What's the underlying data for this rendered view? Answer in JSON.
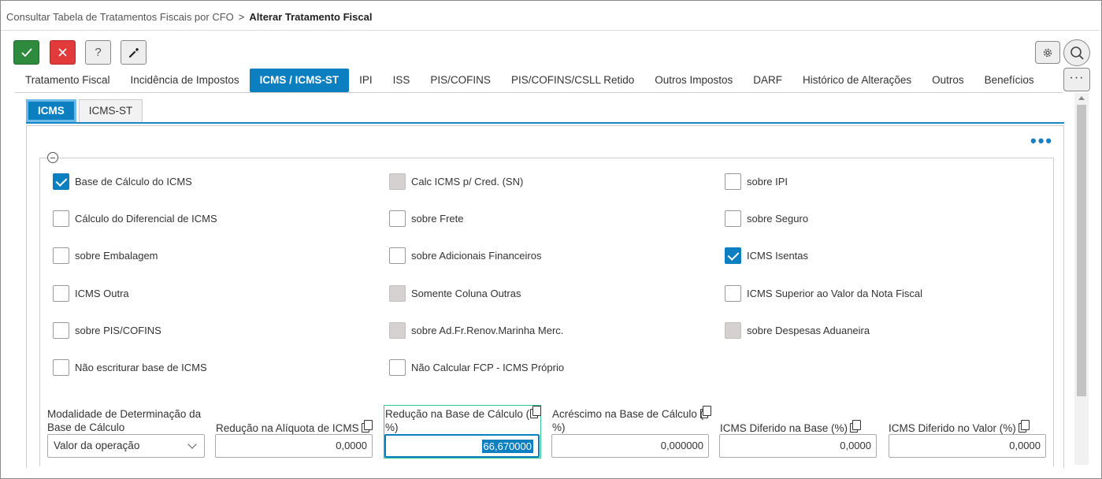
{
  "breadcrumb": {
    "parent": "Consultar Tabela de Tratamentos Fiscais por CFO",
    "separator": ">",
    "current": "Alterar Tratamento Fiscal"
  },
  "toolbar": {
    "ok_icon": "check-icon",
    "cancel_icon": "close-icon",
    "help_label": "?",
    "tool_icon": "wrench-icon",
    "settings_icon": "gear-icon",
    "search_icon": "search-icon",
    "more_label": "···"
  },
  "tabs": [
    {
      "label": "Tratamento Fiscal"
    },
    {
      "label": "Incidência de Impostos"
    },
    {
      "label": "ICMS / ICMS-ST"
    },
    {
      "label": "IPI"
    },
    {
      "label": "ISS"
    },
    {
      "label": "PIS/COFINS"
    },
    {
      "label": "PIS/COFINS/CSLL Retido"
    },
    {
      "label": "Outros Impostos"
    },
    {
      "label": "DARF"
    },
    {
      "label": "Histórico de Alterações"
    },
    {
      "label": "Outros"
    },
    {
      "label": "Benefícios"
    }
  ],
  "active_tab": "ICMS / ICMS-ST",
  "subtabs": [
    {
      "label": "ICMS"
    },
    {
      "label": "ICMS-ST"
    }
  ],
  "panel_menu": "•••",
  "checkboxes": [
    {
      "label": "Base de Cálculo do ICMS",
      "state": "checked"
    },
    {
      "label": "Calc ICMS p/ Cred. (SN)",
      "state": "disabled"
    },
    {
      "label": "sobre IPI",
      "state": "unchecked"
    },
    {
      "label": "Cálculo do Diferencial de ICMS",
      "state": "unchecked"
    },
    {
      "label": "sobre Frete",
      "state": "unchecked"
    },
    {
      "label": "sobre Seguro",
      "state": "unchecked"
    },
    {
      "label": "sobre Embalagem",
      "state": "unchecked"
    },
    {
      "label": "sobre Adicionais Financeiros",
      "state": "unchecked"
    },
    {
      "label": "ICMS Isentas",
      "state": "checked"
    },
    {
      "label": "ICMS Outra",
      "state": "unchecked"
    },
    {
      "label": "Somente Coluna Outras",
      "state": "disabled"
    },
    {
      "label": "ICMS Superior ao Valor da Nota Fiscal",
      "state": "unchecked"
    },
    {
      "label": "sobre PIS/COFINS",
      "state": "unchecked"
    },
    {
      "label": "sobre Ad.Fr.Renov.Marinha Merc.",
      "state": "disabled"
    },
    {
      "label": "sobre Despesas Aduaneira",
      "state": "disabled"
    },
    {
      "label": "Não escriturar base de ICMS",
      "state": "unchecked"
    },
    {
      "label": "Não Calcular FCP - ICMS Próprio",
      "state": "unchecked"
    }
  ],
  "fields": {
    "modalidade": {
      "label1": "Modalidade de Determinação da",
      "label2": "Base de Cálculo",
      "value": "Valor da operação"
    },
    "reducao_aliquota": {
      "label": "Redução na Alíquota de ICMS",
      "value": "0,0000"
    },
    "reducao_base": {
      "label1": "Redução na Base de Cálculo (",
      "label2": "%)",
      "value": "66,670000"
    },
    "acrescimo_base": {
      "label1": "Acréscimo na Base de Cálculo (",
      "label2": "%)",
      "value": "0,000000"
    },
    "diferido_base": {
      "label": "ICMS Diferido na Base (%)",
      "value": "0,0000"
    },
    "diferido_valor": {
      "label": "ICMS Diferido no Valor (%)",
      "value": "0,0000"
    }
  }
}
